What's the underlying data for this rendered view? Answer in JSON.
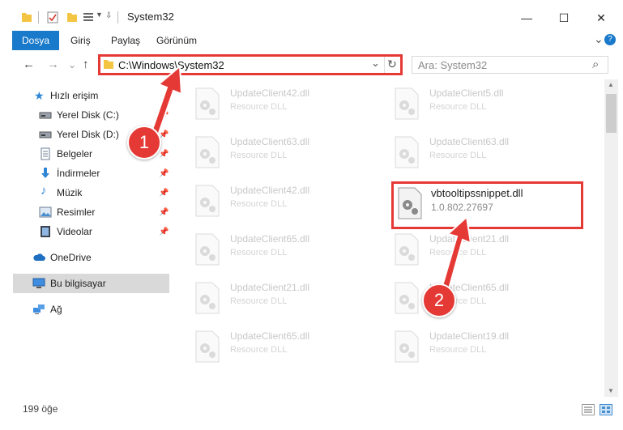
{
  "window": {
    "title": "System32",
    "minimize_glyph": "—",
    "maximize_glyph": "☐",
    "close_glyph": "✕"
  },
  "ribbon": {
    "tabs": [
      "Dosya",
      "Giriş",
      "Paylaş",
      "Görünüm"
    ],
    "expand_glyph": "⌄",
    "help_glyph": "?"
  },
  "nav": {
    "back": "←",
    "forward": "→",
    "recent": "⌄",
    "up": "↑",
    "address": "C:\\Windows\\System32",
    "dropdown": "⌄",
    "refresh": "↻",
    "search_placeholder": "Ara: System32",
    "search_glyph": "⌕"
  },
  "sidebar": {
    "items": [
      {
        "label": "Hızlı erişim",
        "icon": "star-icon",
        "pinned": false
      },
      {
        "label": "Yerel Disk (C:)",
        "icon": "drive-icon",
        "pinned": true
      },
      {
        "label": "Yerel Disk (D:)",
        "icon": "drive-icon",
        "pinned": true
      },
      {
        "label": "Belgeler",
        "icon": "documents-icon",
        "pinned": true
      },
      {
        "label": "İndirmeler",
        "icon": "download-icon",
        "pinned": true
      },
      {
        "label": "Müzik",
        "icon": "music-icon",
        "pinned": true
      },
      {
        "label": "Resimler",
        "icon": "pictures-icon",
        "pinned": true
      },
      {
        "label": "Videolar",
        "icon": "video-icon",
        "pinned": true
      },
      {
        "label": "OneDrive",
        "icon": "cloud-icon",
        "pinned": false
      },
      {
        "label": "Bu bilgisayar",
        "icon": "computer-icon",
        "pinned": false,
        "selected": true
      },
      {
        "label": "Ağ",
        "icon": "network-icon",
        "pinned": false
      }
    ],
    "pin_glyph": "📌"
  },
  "files": [
    {
      "name": "UpdateClient42.dll",
      "desc": "Resource DLL"
    },
    {
      "name": "UpdateClient5.dll",
      "desc": "Resource DLL"
    },
    {
      "name": "UpdateClient63.dll",
      "desc": "Resource DLL"
    },
    {
      "name": "UpdateClient63.dll",
      "desc": "Resource DLL"
    },
    {
      "name": "UpdateClient42.dll",
      "desc": "Resource DLL"
    },
    {
      "name": "vbtooltipssnippet.dll",
      "desc": "1.0.802.27697",
      "highlighted": true
    },
    {
      "name": "UpdateClient65.dll",
      "desc": "Resource DLL"
    },
    {
      "name": "UpdateClient21.dll",
      "desc": "Resource DLL"
    },
    {
      "name": "UpdateClient21.dll",
      "desc": "Resource DLL"
    },
    {
      "name": "UpdateClient65.dll",
      "desc": "Resource DLL"
    },
    {
      "name": "UpdateClient65.dll",
      "desc": "Resource DLL"
    },
    {
      "name": "UpdateClient19.dll",
      "desc": "Resource DLL"
    }
  ],
  "status": {
    "count": "199 öğe"
  },
  "annotations": {
    "step1": "1",
    "step2": "2",
    "color": "#e53935"
  },
  "colors": {
    "accent": "#1979ca",
    "selection": "#d9d9d9",
    "highlight": "#e53935"
  }
}
